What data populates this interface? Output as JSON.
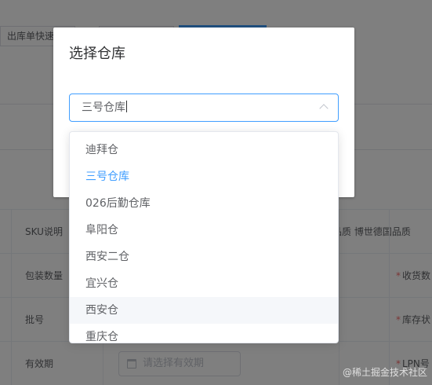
{
  "background": {
    "toolbar_tab": "出库单快速",
    "table": {
      "rows": [
        {
          "label": "SKU说明",
          "right_text": "品质 博世德国品质"
        },
        {
          "label": "包装数量",
          "right_label": "收货数"
        },
        {
          "label": "批号",
          "right_label": "库存状"
        },
        {
          "label": "有效期",
          "date_placeholder": "请选择有效期",
          "right_label": "LPN号"
        }
      ],
      "required_mark": "*"
    }
  },
  "dialog": {
    "title": "选择仓库",
    "select": {
      "value": "三号仓库"
    }
  },
  "dropdown": {
    "options": [
      {
        "label": "迪拜仓"
      },
      {
        "label": "三号仓库"
      },
      {
        "label": "026后勤仓库"
      },
      {
        "label": "阜阳仓"
      },
      {
        "label": "西安二仓"
      },
      {
        "label": "宜兴仓"
      },
      {
        "label": "西安仓"
      },
      {
        "label": "重庆仓"
      }
    ],
    "selected_index": 1,
    "hover_index": 6
  },
  "watermark": "@稀土掘金技术社区",
  "colors": {
    "accent": "#409eff",
    "required": "#f56c6c",
    "overlay": "rgba(0,0,0,0.5)"
  }
}
